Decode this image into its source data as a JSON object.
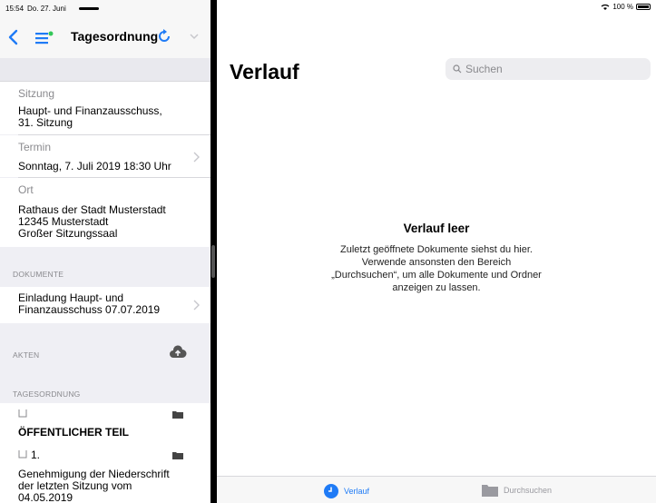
{
  "statusbar": {
    "time": "15:54",
    "date": "Do. 27. Juni",
    "battery": "100 %"
  },
  "nav": {
    "title": "Tagesordnung"
  },
  "details": {
    "sitzung_label": "Sitzung",
    "sitzung_value_line1": "Haupt- und Finanzausschuss,",
    "sitzung_value_line2": "31. Sitzung",
    "termin_label": "Termin",
    "termin_value": "Sonntag, 7. Juli 2019 18:30 Uhr",
    "ort_label": "Ort",
    "ort_line1": "Rathaus der Stadt Musterstadt",
    "ort_line2": "12345 Musterstadt",
    "ort_line3": "Großer Sitzungssaal"
  },
  "dokumente": {
    "header": "DOKUMENTE",
    "item_line1": "Einladung Haupt- und",
    "item_line2": "Finanzausschuss 07.07.2019"
  },
  "akten": {
    "header": "AKTEN"
  },
  "tagesordnung": {
    "header": "TAGESORDNUNG",
    "section_title": "ÖFFENTLICHER TEIL",
    "item_number": "1.",
    "item_line1": "Genehmigung der Niederschrift",
    "item_line2": "der letzten Sitzung vom",
    "item_line3": "04.05.2019"
  },
  "main": {
    "title": "Verlauf",
    "search_placeholder": "Suchen",
    "empty_title": "Verlauf leer",
    "empty_line1": "Zuletzt geöffnete Dokumente siehst du hier.",
    "empty_line2": "Verwende ansonsten den Bereich",
    "empty_line3": "„Durchsuchen“, um alle Dokumente und Ordner",
    "empty_line4": "anzeigen zu lassen."
  },
  "tabs": {
    "verlauf": "Verlauf",
    "durchsuchen": "Durchsuchen"
  },
  "colors": {
    "accent": "#1f7bf6",
    "gray": "#8a8a8e"
  }
}
